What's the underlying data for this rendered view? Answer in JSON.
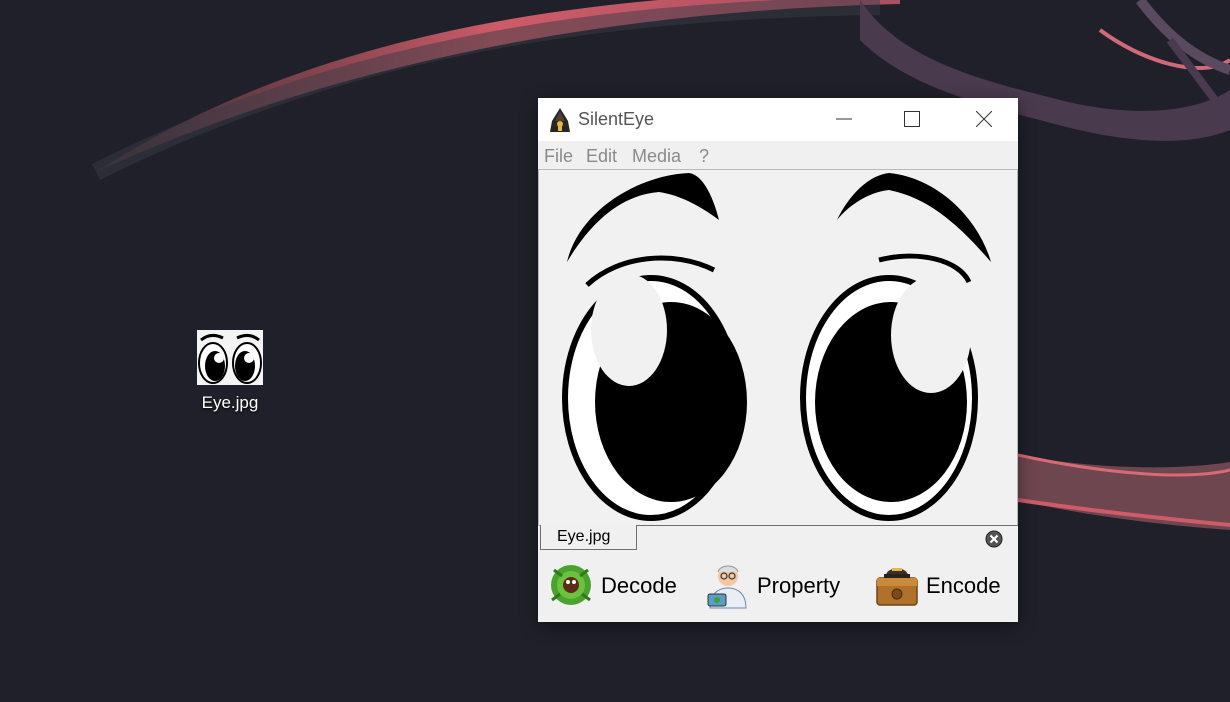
{
  "desktop": {
    "icon": {
      "label": "Eye.jpg",
      "icon": "eyes-thumbnail"
    }
  },
  "window": {
    "title": "SilentEye",
    "app_icon": "hooded-figure-icon",
    "controls": {
      "minimize": "minimize-icon",
      "maximize": "maximize-icon",
      "close": "close-icon"
    }
  },
  "menu": {
    "file": "File",
    "edit": "Edit",
    "media": "Media",
    "help": "?"
  },
  "tab": {
    "label": "Eye.jpg",
    "close_icon": "close-circle-icon"
  },
  "actions": {
    "decode": {
      "label": "Decode",
      "icon": "decode-bug-icon"
    },
    "property": {
      "label": "Property",
      "icon": "property-doctor-icon"
    },
    "encode": {
      "label": "Encode",
      "icon": "encode-safe-icon"
    }
  },
  "colors": {
    "desktop_bg": "#1f2029",
    "wallpaper_accent": "#e0626e",
    "window_bg": "#f0f0f0"
  }
}
